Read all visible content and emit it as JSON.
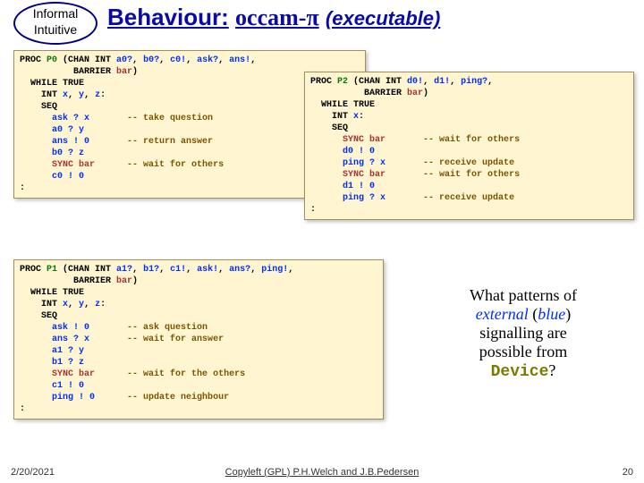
{
  "header": {
    "oval_line1": "Informal",
    "oval_line2": "Intuitive",
    "title_word": "Behaviour:",
    "title_occam": "occam-π",
    "title_exec": "(executable)"
  },
  "p0": {
    "l1a": "PROC ",
    "l1pn": "P0",
    "l1b": " (CHAN INT ",
    "l1c": "a0?",
    "l1d": ", ",
    "l1e": "b0?",
    "l1f": ", ",
    "l1g": "c0!",
    "l1h": ", ",
    "l1i": "ask?",
    "l1j": ", ",
    "l1k": "ans!",
    "l1l": ",",
    "l2a": "          BARRIER ",
    "l2b": "bar",
    "l2c": ")",
    "l3": "  WHILE TRUE",
    "l4a": "    INT ",
    "l4b": "x",
    "l4c": ", ",
    "l4d": "y",
    "l4e": ", ",
    "l4f": "z",
    "l4g": ":",
    "l5": "    SEQ",
    "l6a": "      ",
    "l6b": "ask ? x",
    "l6c": "       ",
    "l6d": "-- take question",
    "l7a": "      ",
    "l7b": "a0 ? y",
    "l8a": "      ",
    "l8b": "ans ! 0",
    "l8c": "       ",
    "l8d": "-- return answer",
    "l9a": "      ",
    "l9b": "b0 ? z",
    "l10a": "      ",
    "l10b": "SYNC bar",
    "l10c": "      ",
    "l10d": "-- wait for others",
    "l11a": "      ",
    "l11b": "c0 ! 0",
    "l12": ":"
  },
  "p2": {
    "l1a": "PROC ",
    "l1pn": "P2",
    "l1b": " (CHAN INT ",
    "l1c": "d0!",
    "l1d": ", ",
    "l1e": "d1!",
    "l1f": ", ",
    "l1g": "ping?",
    "l1h": ",",
    "l2a": "          BARRIER ",
    "l2b": "bar",
    "l2c": ")",
    "l3": "  WHILE TRUE",
    "l4a": "    INT ",
    "l4b": "x",
    "l4c": ":",
    "l5": "    SEQ",
    "l6a": "      ",
    "l6b": "SYNC bar",
    "l6c": "       ",
    "l6d": "-- wait for others",
    "l7a": "      ",
    "l7b": "d0 ! 0",
    "l8a": "      ",
    "l8b": "ping ? x",
    "l8c": "       ",
    "l8d": "-- receive update",
    "l9a": "      ",
    "l9b": "SYNC bar",
    "l9c": "       ",
    "l9d": "-- wait for others",
    "l10a": "      ",
    "l10b": "d1 ! 0",
    "l11a": "      ",
    "l11b": "ping ? x",
    "l11c": "       ",
    "l11d": "-- receive update",
    "l12": ":"
  },
  "p1": {
    "l1a": "PROC ",
    "l1pn": "P1",
    "l1b": " (CHAN INT ",
    "l1c": "a1?",
    "l1d": ", ",
    "l1e": "b1?",
    "l1f": ", ",
    "l1g": "c1!",
    "l1h": ", ",
    "l1i": "ask!",
    "l1j": ", ",
    "l1k": "ans?",
    "l1l": ", ",
    "l1m": "ping!",
    "l1n": ",",
    "l2a": "          BARRIER ",
    "l2b": "bar",
    "l2c": ")",
    "l3": "  WHILE TRUE",
    "l4a": "    INT ",
    "l4b": "x",
    "l4c": ", ",
    "l4d": "y",
    "l4e": ", ",
    "l4f": "z",
    "l4g": ":",
    "l5": "    SEQ",
    "l6a": "      ",
    "l6b": "ask ! 0",
    "l6c": "       ",
    "l6d": "-- ask question",
    "l7a": "      ",
    "l7b": "ans ? x",
    "l7c": "       ",
    "l7d": "-- wait for answer",
    "l8a": "      ",
    "l8b": "a1 ? y",
    "l9a": "      ",
    "l9b": "b1 ? z",
    "l10a": "      ",
    "l10b": "SYNC bar",
    "l10c": "      ",
    "l10d": "-- wait for the others",
    "l11a": "      ",
    "l11b": "c1 ! 0",
    "l12a": "      ",
    "l12b": "ping ! 0",
    "l12c": "      ",
    "l12d": "-- update neighbour",
    "l13": ":"
  },
  "question": {
    "l1": "What patterns of",
    "l2a": "external",
    "l2b": " (",
    "l2c": "blue",
    "l2d": ")",
    "l3": "signalling are",
    "l4": "possible from",
    "l5a": "Device",
    "l5b": "?"
  },
  "footer": {
    "date": "2/20/2021",
    "mid": "Copyleft (GPL) P.H.Welch and J.B.Pedersen",
    "num": "20"
  }
}
